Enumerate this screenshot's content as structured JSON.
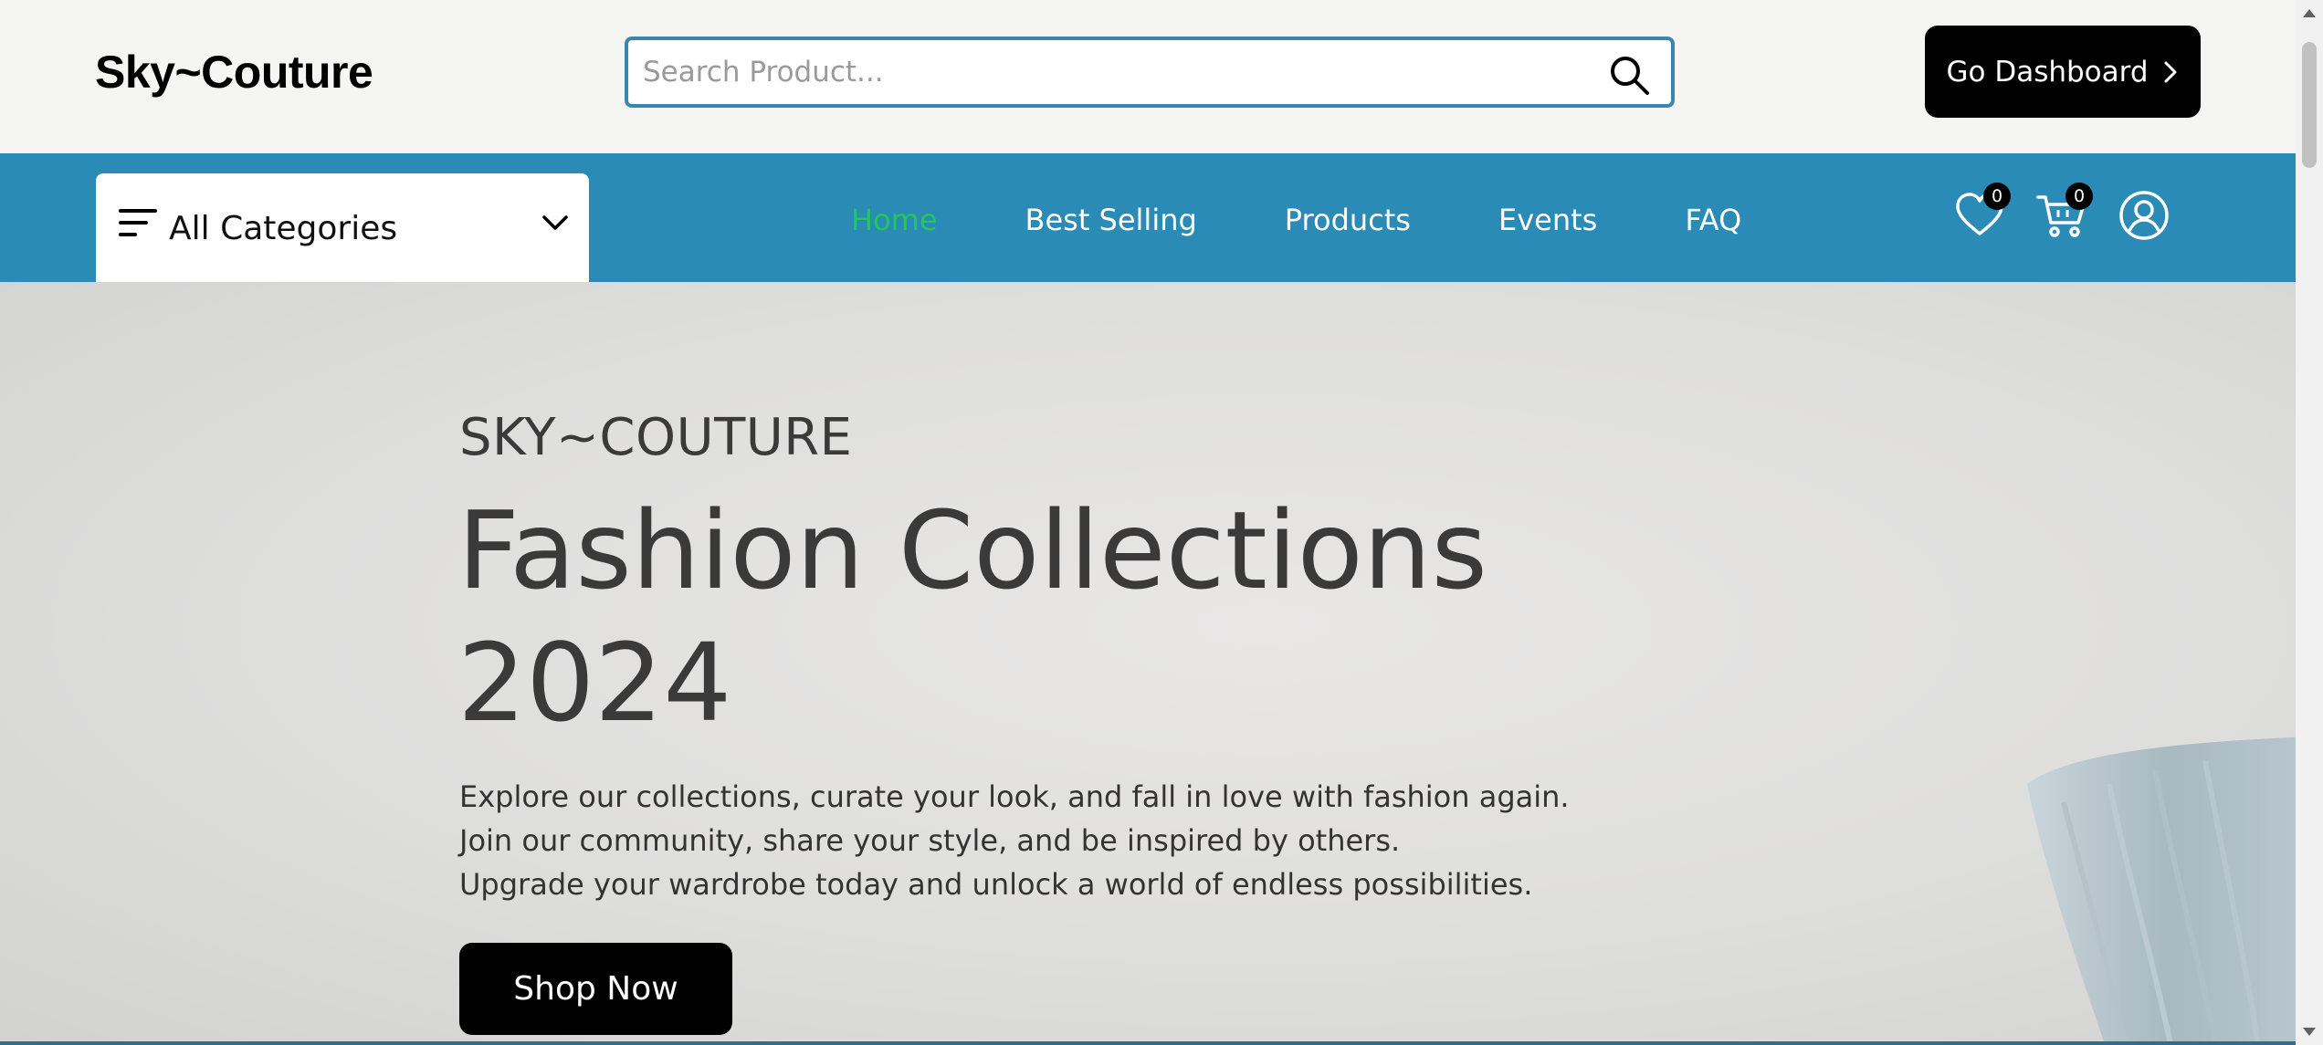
{
  "header": {
    "logo": "Sky~Couture",
    "search_placeholder": "Search Product...",
    "dashboard_label": "Go Dashboard"
  },
  "navbar": {
    "categories_label": "All Categories",
    "links": [
      {
        "label": "Home",
        "active": true
      },
      {
        "label": "Best Selling",
        "active": false
      },
      {
        "label": "Products",
        "active": false
      },
      {
        "label": "Events",
        "active": false
      },
      {
        "label": "FAQ",
        "active": false
      }
    ],
    "wishlist_count": "0",
    "cart_count": "0"
  },
  "hero": {
    "kicker": "SKY~COUTURE",
    "title_line1": "Fashion Collections",
    "title_line2": "2024",
    "desc_lines": [
      "Explore our collections, curate your look, and fall in love with fashion again.",
      "Join our community, share your style, and be inspired by others.",
      "Upgrade your wardrobe today and unlock a world of endless possibilities."
    ],
    "cta_label": "Shop Now"
  },
  "colors": {
    "nav_bg": "#2a8bb7",
    "active_link": "#22c55e",
    "search_border": "#3a86ae",
    "button_bg": "#000000"
  },
  "icons": {
    "search": "search-icon",
    "dashboard_chevron": "chevron-right-icon",
    "categories": "filter-lines-icon",
    "categories_chevron": "chevron-down-icon",
    "wishlist": "heart-icon",
    "cart": "cart-icon",
    "profile": "user-circle-icon"
  }
}
